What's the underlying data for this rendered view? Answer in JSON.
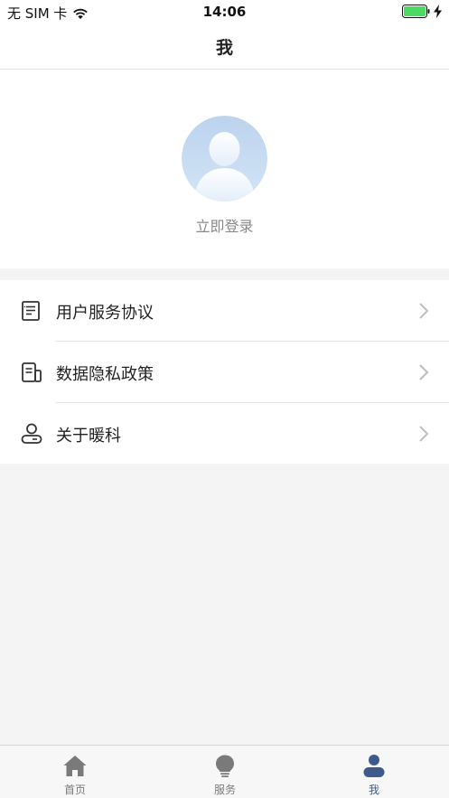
{
  "status_bar": {
    "carrier": "无 SIM 卡",
    "time": "14:06"
  },
  "header": {
    "title": "我"
  },
  "profile": {
    "login_label": "立即登录"
  },
  "menu": {
    "items": [
      {
        "label": "用户服务协议",
        "icon": "document-list-icon"
      },
      {
        "label": "数据隐私政策",
        "icon": "document-phone-icon"
      },
      {
        "label": "关于暖科",
        "icon": "person-card-icon"
      }
    ]
  },
  "tab_bar": {
    "tabs": [
      {
        "label": "首页",
        "icon": "home-icon",
        "active": false
      },
      {
        "label": "服务",
        "icon": "lightbulb-icon",
        "active": false
      },
      {
        "label": "我",
        "icon": "user-icon",
        "active": true
      }
    ]
  },
  "colors": {
    "accent": "#3d5a8a",
    "inactive_tab": "#7a7a7a",
    "battery": "#4cd964",
    "avatar_bg": "#c5daf0"
  }
}
